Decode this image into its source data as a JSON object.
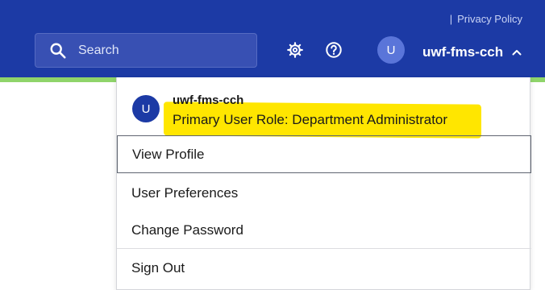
{
  "header": {
    "privacy_separator": "|",
    "privacy_label": "Privacy Policy",
    "search_placeholder": "Search",
    "user_initial": "U",
    "username": "uwf-fms-cch",
    "colors": {
      "bar": "#1c3aa5",
      "accent_strip": "#8fd46a",
      "highlight": "#ffe600"
    },
    "icons": [
      "search-icon",
      "gear-icon",
      "help-icon",
      "chevron-up-icon"
    ]
  },
  "menu": {
    "avatar_initial": "U",
    "name": "uwf-fms-cch",
    "role_label": "Primary User Role: Department Administrator",
    "items": [
      {
        "label": "View Profile",
        "selected": true
      },
      {
        "label": "User Preferences",
        "selected": false
      },
      {
        "label": "Change Password",
        "selected": false
      },
      {
        "label": "Sign Out",
        "selected": false
      }
    ]
  }
}
